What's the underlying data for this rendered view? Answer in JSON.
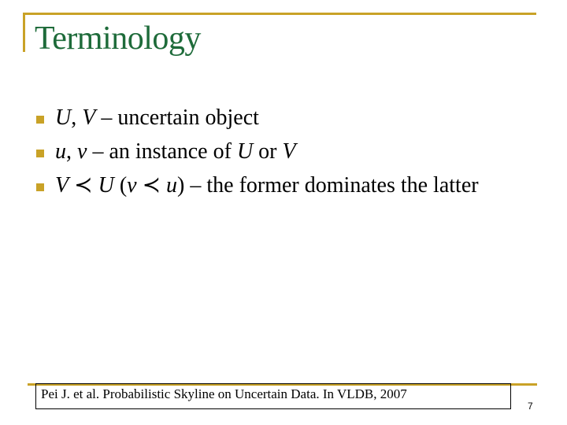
{
  "slide": {
    "title": "Terminology",
    "bullets": [
      {
        "parts": [
          {
            "text": "U",
            "italic": true
          },
          {
            "text": ", ",
            "italic": false
          },
          {
            "text": "V",
            "italic": true
          },
          {
            "text": " – uncertain object",
            "italic": false
          }
        ]
      },
      {
        "parts": [
          {
            "text": "u",
            "italic": true
          },
          {
            "text": ", ",
            "italic": false
          },
          {
            "text": "v",
            "italic": true
          },
          {
            "text": " – an instance of ",
            "italic": false
          },
          {
            "text": "U",
            "italic": true
          },
          {
            "text": " or ",
            "italic": false
          },
          {
            "text": "V",
            "italic": true
          }
        ]
      },
      {
        "parts": [
          {
            "text": "V",
            "italic": true
          },
          {
            "text": " ≺ ",
            "italic": false
          },
          {
            "text": "U",
            "italic": true
          },
          {
            "text": " (",
            "italic": false
          },
          {
            "text": "v",
            "italic": true
          },
          {
            "text": " ≺ ",
            "italic": false
          },
          {
            "text": "u",
            "italic": true
          },
          {
            "text": ") – the former dominates the latter",
            "italic": false
          }
        ]
      }
    ],
    "citation": "Pei J. et al. Probabilistic Skyline on Uncertain Data. In VLDB, 2007",
    "page_number": "7",
    "colors": {
      "accent": "#c9a227",
      "title": "#1e6b3a"
    }
  }
}
